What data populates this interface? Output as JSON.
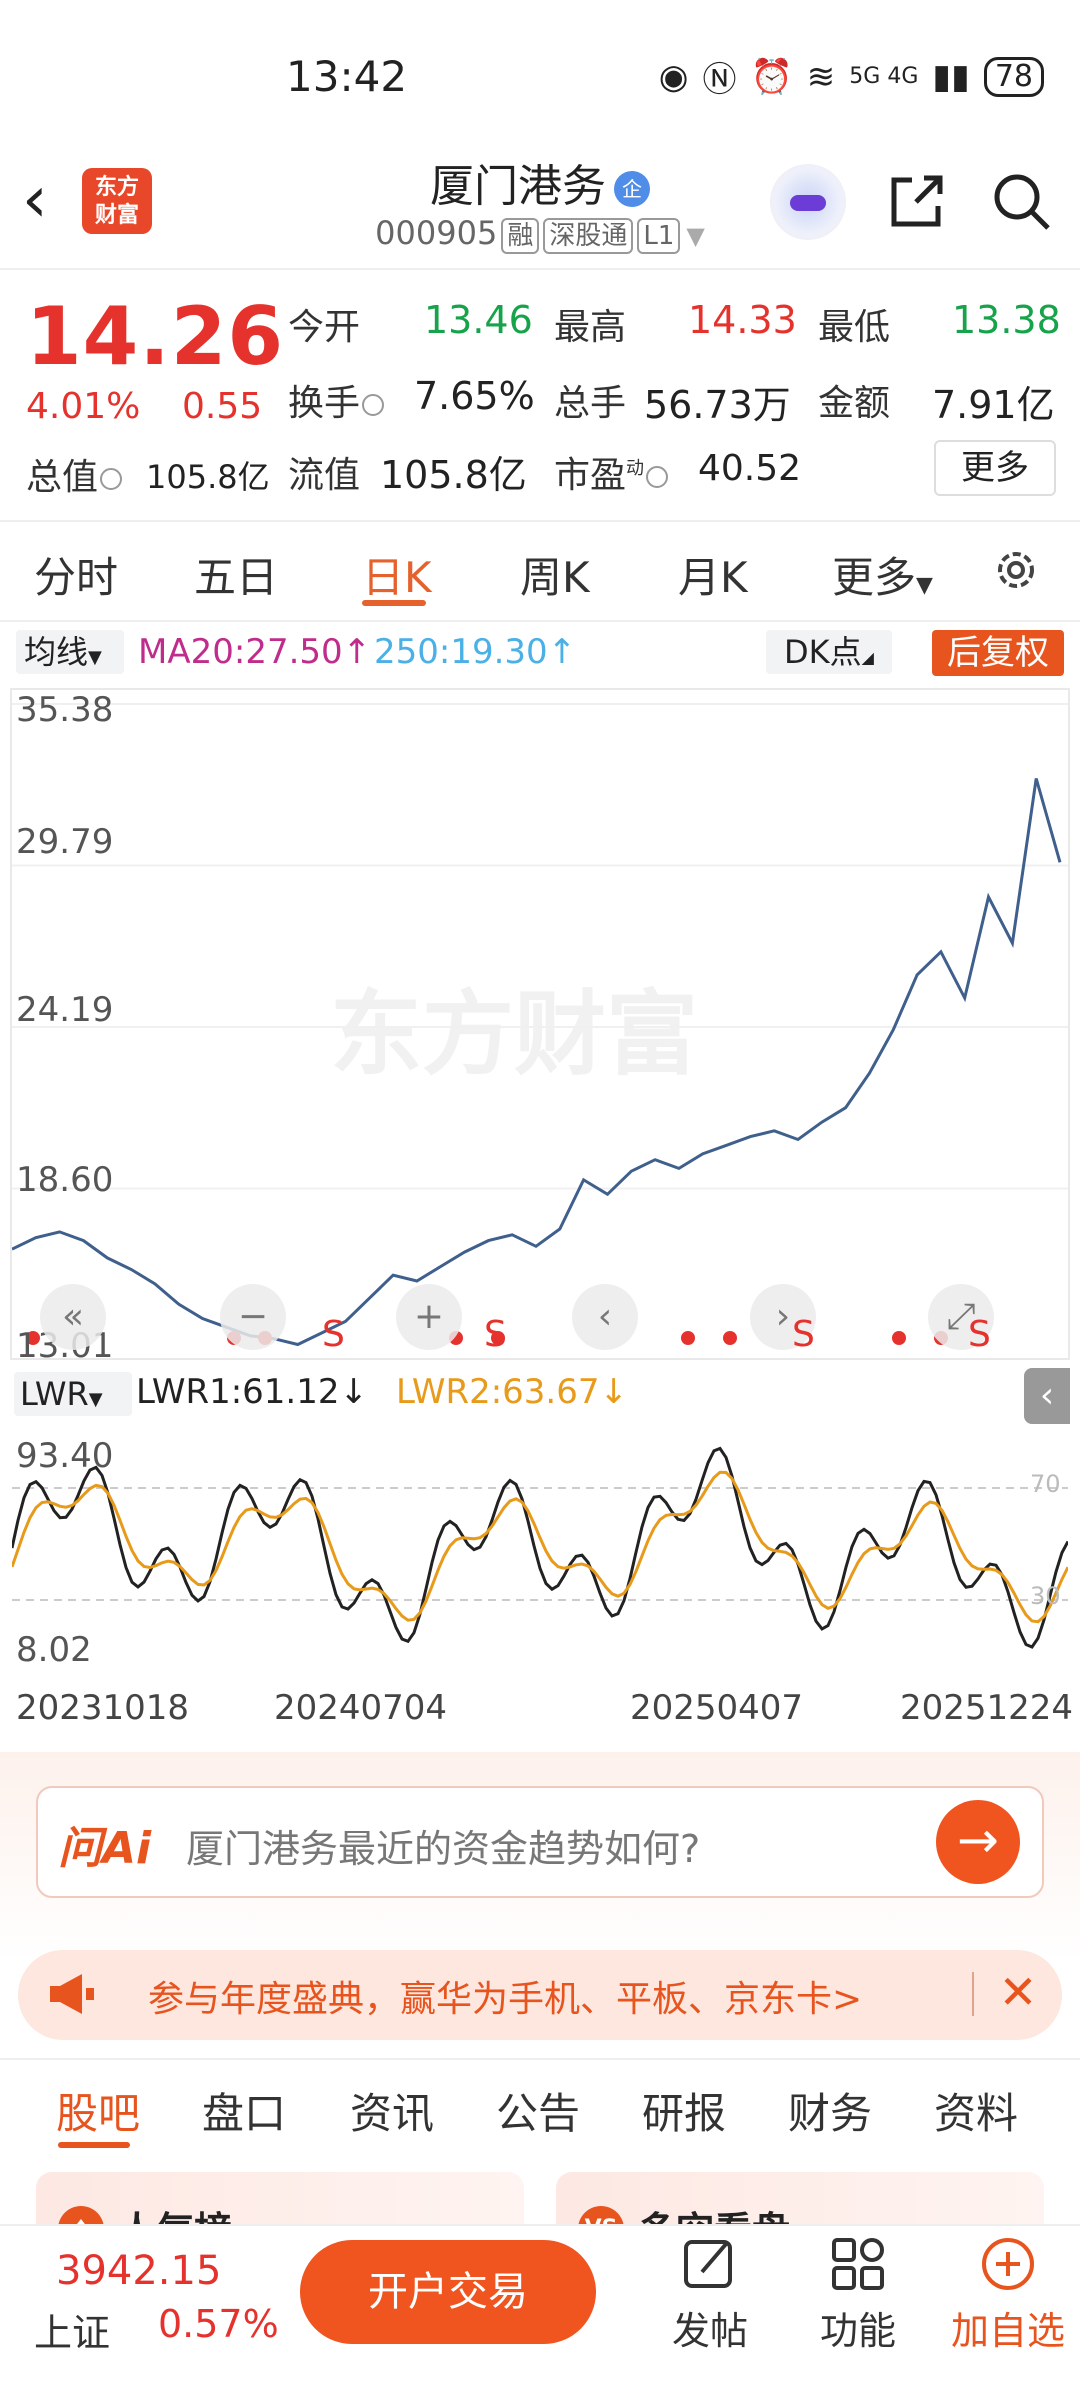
{
  "status": {
    "time": "13:42",
    "network": "5G 4G",
    "battery": "78"
  },
  "header": {
    "title": "厦门港务",
    "badge": "企",
    "code": "000905",
    "tags": [
      "融",
      "深股通",
      "L1"
    ],
    "logo_text": "东方\n财富"
  },
  "quote": {
    "price": "14.26",
    "change_pct": "4.01%",
    "change": "0.55",
    "rows": [
      [
        {
          "label": "今开",
          "value": "13.46",
          "color": "green"
        },
        {
          "label": "最高",
          "value": "14.33",
          "color": "red"
        },
        {
          "label": "最低",
          "value": "13.38",
          "color": "green"
        }
      ],
      [
        {
          "label": "换手",
          "value": "7.65%",
          "color": "dark"
        },
        {
          "label": "总手",
          "value": "56.73万",
          "color": "dark"
        },
        {
          "label": "金额",
          "value": "7.91亿",
          "color": "dark"
        }
      ]
    ],
    "total_value_label": "总值",
    "total_value": "105.8亿",
    "float_value_label": "流值",
    "float_value": "105.8亿",
    "pe_label": "市盈",
    "pe_sup": "动",
    "pe_value": "40.52",
    "more": "更多"
  },
  "chart_tabs": {
    "items": [
      "分时",
      "五日",
      "日K",
      "周K",
      "月K",
      "更多"
    ],
    "active": "日K"
  },
  "indicators": {
    "ma_select": "均线",
    "ma20": "MA20:27.50",
    "ma250": "250:19.30",
    "dk": "DK点",
    "fuquan": "后复权"
  },
  "chart": {
    "watermark": "东方财富",
    "price_axis": [
      "35.38",
      "29.79",
      "24.19",
      "18.60",
      "13.01"
    ],
    "lwr_select": "LWR",
    "lwr1": "LWR1:61.12",
    "lwr2": "LWR2:63.67",
    "lwr_axis_top": "93.40",
    "lwr_axis_bottom": "8.02",
    "lwr_ref_top": "70",
    "lwr_ref_bottom": "30",
    "x_axis": [
      "20231018",
      "20240704",
      "20250407",
      "20251224"
    ],
    "nav_buttons": [
      "«",
      "−",
      "+",
      "‹",
      "›",
      "⤢"
    ],
    "signal_s": "S",
    "colors": {
      "price_line": "#3f5f8c",
      "lwr1": "#222222",
      "lwr2": "#e89a1a",
      "signal": "#e5322d"
    }
  },
  "chart_data": {
    "type": "line",
    "title": "",
    "series": [
      {
        "name": "",
        "values": [
          16.5,
          16.9,
          17.1,
          16.8,
          16.2,
          15.8,
          15.3,
          14.6,
          14.1,
          13.8,
          13.5,
          13.4,
          13.2,
          13.6,
          14.0,
          14.8,
          15.6,
          15.4,
          15.9,
          16.4,
          16.8,
          17.0,
          16.6,
          17.2,
          18.9,
          18.4,
          19.2,
          19.6,
          19.3,
          19.8,
          20.1,
          20.4,
          20.6,
          20.3,
          20.9,
          21.4,
          22.6,
          24.1,
          26.0,
          26.8,
          25.2,
          28.7,
          27.1,
          32.8,
          29.9
        ]
      }
    ],
    "ylim": [
      13.01,
      35.38
    ]
  },
  "ai": {
    "logo": "问Ai",
    "prompt": "厦门港务最近的资金趋势如何?"
  },
  "banner": {
    "text": "参与年度盛典，赢华为手机、平板、京东卡>"
  },
  "bottom_tabs": {
    "items": [
      "股吧",
      "盘口",
      "资讯",
      "公告",
      "研报",
      "财务",
      "资料"
    ],
    "active": "股吧"
  },
  "cards": [
    {
      "title": "人气榜"
    },
    {
      "title": "多空看盘"
    }
  ],
  "bottom_bar": {
    "index_value": "3942.15",
    "index_name": "上证",
    "index_change": "0.57%",
    "trade": "开户交易",
    "post": "发帖",
    "functions": "功能",
    "add_watch": "加自选"
  }
}
